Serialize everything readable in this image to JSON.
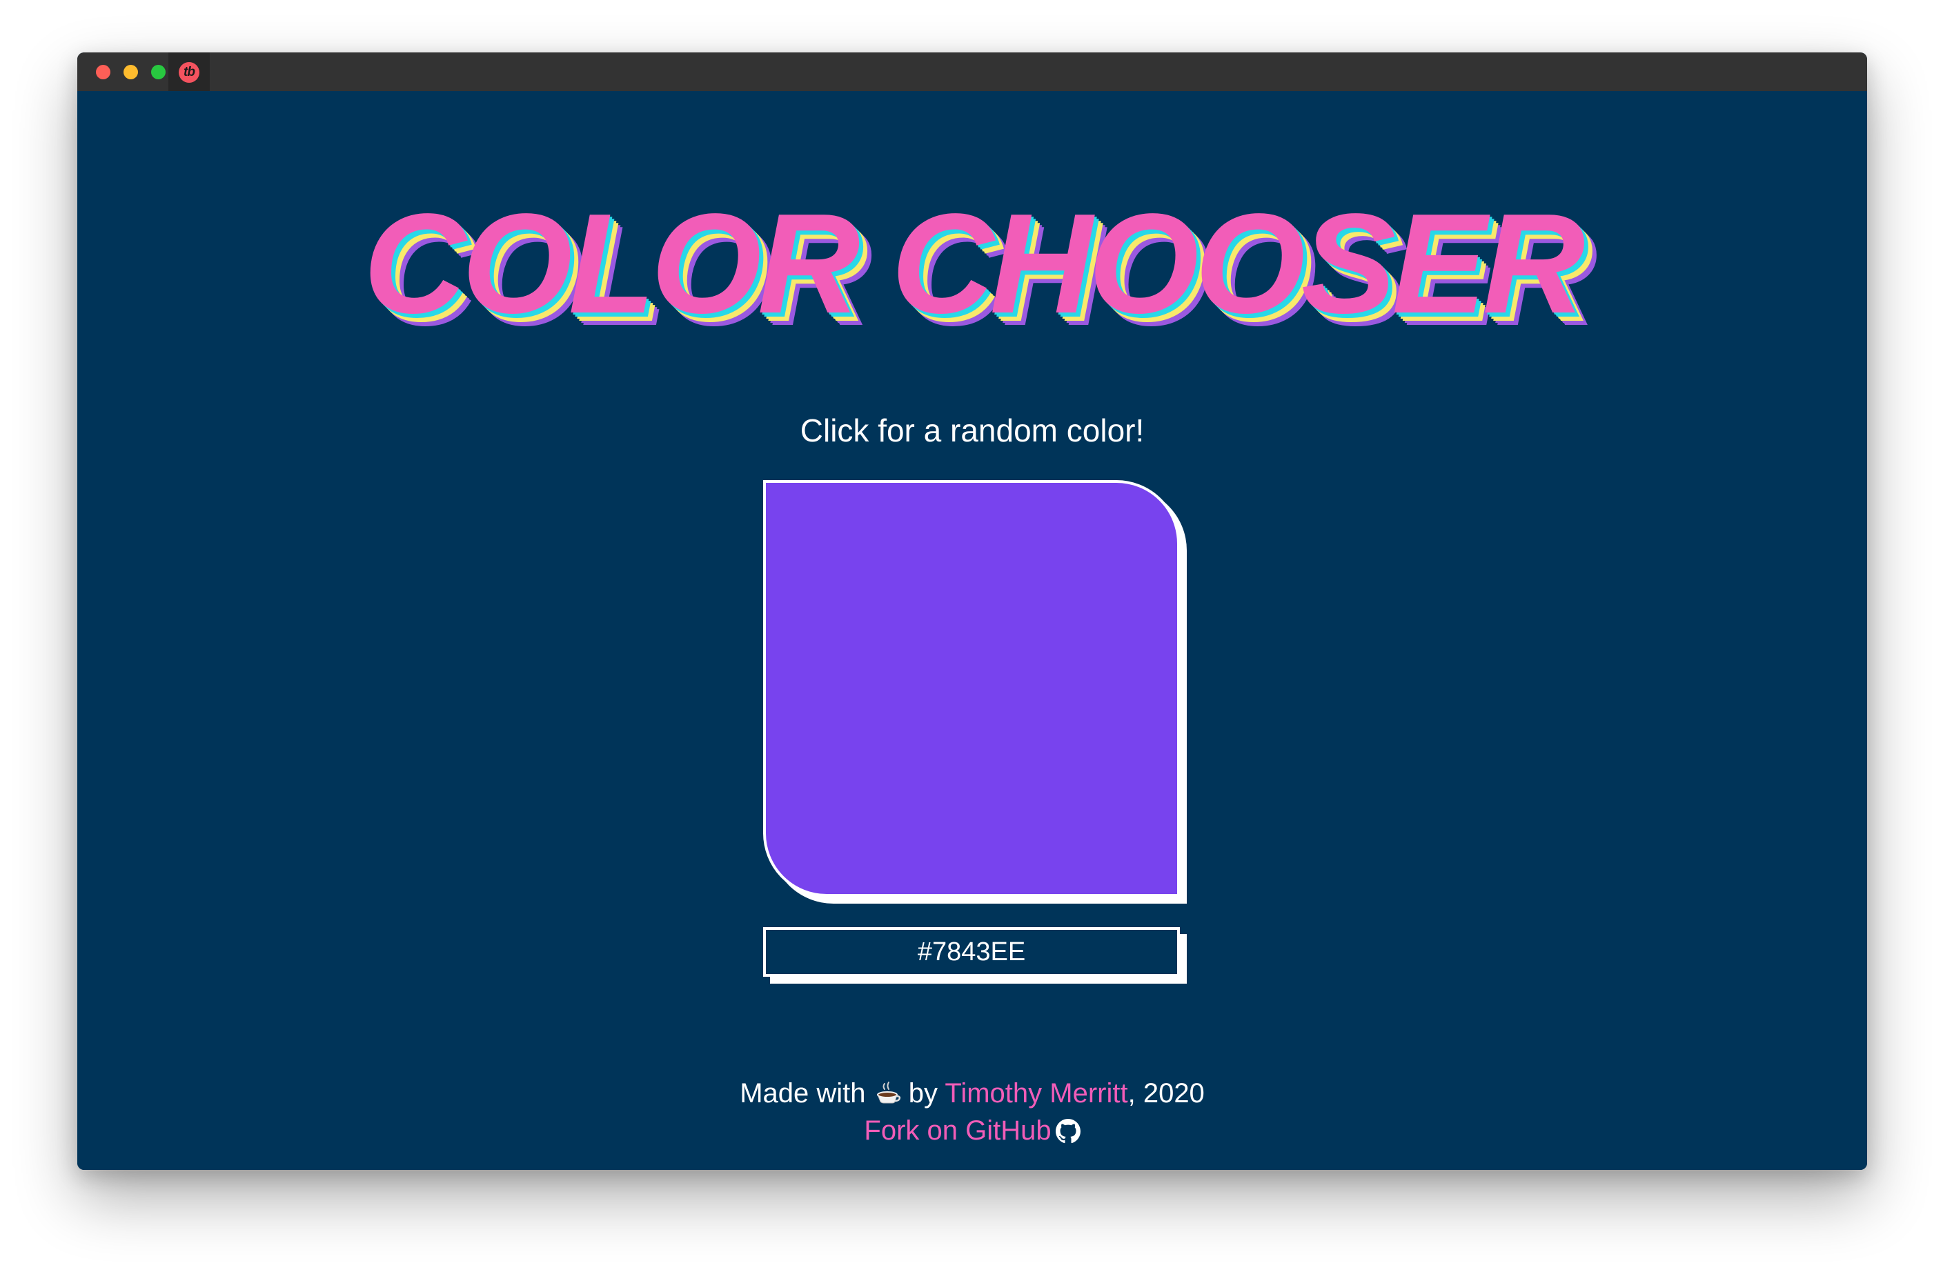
{
  "window": {
    "tab_logo": "tb"
  },
  "colors": {
    "background": "#003459",
    "accent_pink": "#f25db8",
    "swatch": "#7843EE"
  },
  "header": {
    "title": "COLOR CHOOSER"
  },
  "main": {
    "instruction": "Click for a random color!",
    "hex_value": "#7843EE"
  },
  "footer": {
    "made_with": "Made with",
    "coffee_icon": "coffee-icon",
    "by": "by",
    "author": "Timothy Merritt",
    "year": ", 2020",
    "fork_label": "Fork on GitHub",
    "github_icon": "github-icon"
  }
}
